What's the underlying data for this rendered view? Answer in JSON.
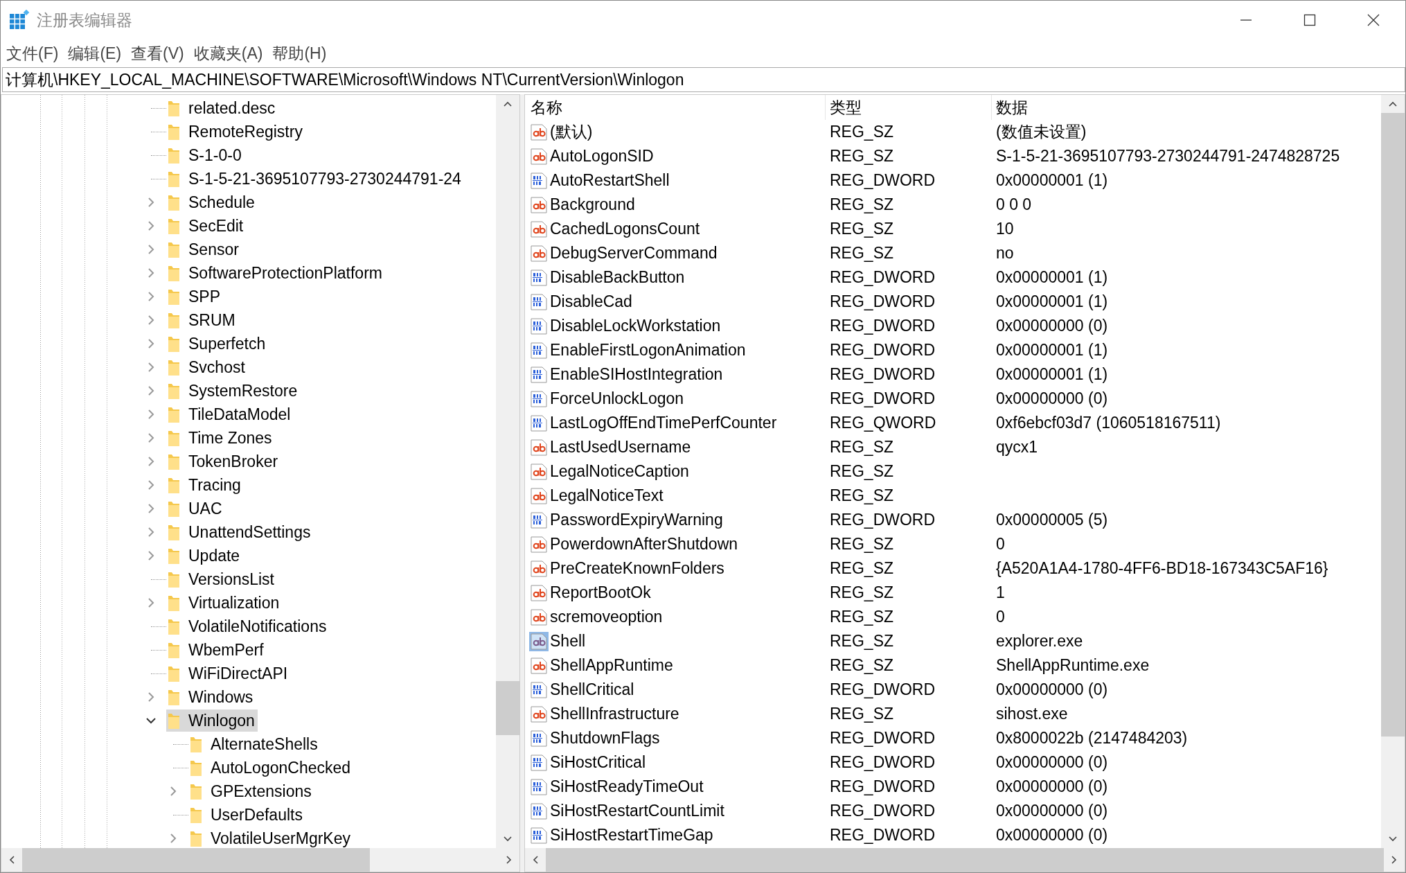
{
  "window": {
    "title": "注册表编辑器"
  },
  "menu": [
    "文件(F)",
    "编辑(E)",
    "查看(V)",
    "收藏夹(A)",
    "帮助(H)"
  ],
  "address": "计算机\\HKEY_LOCAL_MACHINE\\SOFTWARE\\Microsoft\\Windows NT\\CurrentVersion\\Winlogon",
  "tree": {
    "items": [
      {
        "label": "related.desc",
        "selected": false
      },
      {
        "label": "RemoteRegistry",
        "selected": false
      },
      {
        "label": "S-1-0-0",
        "selected": false
      },
      {
        "label": "S-1-5-21-3695107793-2730244791-24",
        "selected": false
      },
      {
        "label": "Schedule",
        "expanded": false,
        "selected": false
      },
      {
        "label": "SecEdit",
        "expanded": false,
        "selected": false
      },
      {
        "label": "Sensor",
        "expanded": false,
        "selected": false
      },
      {
        "label": "SoftwareProtectionPlatform",
        "expanded": false,
        "selected": false
      },
      {
        "label": "SPP",
        "expanded": false,
        "selected": false
      },
      {
        "label": "SRUM",
        "expanded": false,
        "selected": false
      },
      {
        "label": "Superfetch",
        "expanded": false,
        "selected": false
      },
      {
        "label": "Svchost",
        "expanded": false,
        "selected": false
      },
      {
        "label": "SystemRestore",
        "expanded": false,
        "selected": false
      },
      {
        "label": "TileDataModel",
        "expanded": false,
        "selected": false
      },
      {
        "label": "Time Zones",
        "expanded": false,
        "selected": false
      },
      {
        "label": "TokenBroker",
        "expanded": false,
        "selected": false
      },
      {
        "label": "Tracing",
        "expanded": false,
        "selected": false
      },
      {
        "label": "UAC",
        "expanded": false,
        "selected": false
      },
      {
        "label": "UnattendSettings",
        "expanded": false,
        "selected": false
      },
      {
        "label": "Update",
        "expanded": false,
        "selected": false
      },
      {
        "label": "VersionsList",
        "selected": false
      },
      {
        "label": "Virtualization",
        "expanded": false,
        "selected": false
      },
      {
        "label": "VolatileNotifications",
        "selected": false
      },
      {
        "label": "WbemPerf",
        "selected": false
      },
      {
        "label": "WiFiDirectAPI",
        "selected": false
      },
      {
        "label": "Windows",
        "expanded": false,
        "selected": false
      },
      {
        "label": "Winlogon",
        "expanded": true,
        "selected": true,
        "children": [
          {
            "label": "AlternateShells",
            "selected": false
          },
          {
            "label": "AutoLogonChecked",
            "selected": false
          },
          {
            "label": "GPExtensions",
            "expanded": false,
            "selected": false
          },
          {
            "label": "UserDefaults",
            "selected": false
          },
          {
            "label": "VolatileUserMgrKey",
            "expanded": false,
            "selected": false
          }
        ]
      }
    ]
  },
  "table": {
    "columns": [
      "名称",
      "类型",
      "数据"
    ],
    "rows": [
      {
        "kind": "string",
        "name": "(默认)",
        "type": "REG_SZ",
        "data": "(数值未设置)",
        "selected": false
      },
      {
        "kind": "string",
        "name": "AutoLogonSID",
        "type": "REG_SZ",
        "data": "S-1-5-21-3695107793-2730244791-2474828725",
        "selected": false
      },
      {
        "kind": "binary",
        "name": "AutoRestartShell",
        "type": "REG_DWORD",
        "data": "0x00000001 (1)",
        "selected": false
      },
      {
        "kind": "string",
        "name": "Background",
        "type": "REG_SZ",
        "data": "0 0 0",
        "selected": false
      },
      {
        "kind": "string",
        "name": "CachedLogonsCount",
        "type": "REG_SZ",
        "data": "10",
        "selected": false
      },
      {
        "kind": "string",
        "name": "DebugServerCommand",
        "type": "REG_SZ",
        "data": "no",
        "selected": false
      },
      {
        "kind": "binary",
        "name": "DisableBackButton",
        "type": "REG_DWORD",
        "data": "0x00000001 (1)",
        "selected": false
      },
      {
        "kind": "binary",
        "name": "DisableCad",
        "type": "REG_DWORD",
        "data": "0x00000001 (1)",
        "selected": false
      },
      {
        "kind": "binary",
        "name": "DisableLockWorkstation",
        "type": "REG_DWORD",
        "data": "0x00000000 (0)",
        "selected": false
      },
      {
        "kind": "binary",
        "name": "EnableFirstLogonAnimation",
        "type": "REG_DWORD",
        "data": "0x00000001 (1)",
        "selected": false
      },
      {
        "kind": "binary",
        "name": "EnableSIHostIntegration",
        "type": "REG_DWORD",
        "data": "0x00000001 (1)",
        "selected": false
      },
      {
        "kind": "binary",
        "name": "ForceUnlockLogon",
        "type": "REG_DWORD",
        "data": "0x00000000 (0)",
        "selected": false
      },
      {
        "kind": "binary",
        "name": "LastLogOffEndTimePerfCounter",
        "type": "REG_QWORD",
        "data": "0xf6ebcf03d7 (1060518167511)",
        "selected": false
      },
      {
        "kind": "string",
        "name": "LastUsedUsername",
        "type": "REG_SZ",
        "data": "qycx1",
        "selected": false
      },
      {
        "kind": "string",
        "name": "LegalNoticeCaption",
        "type": "REG_SZ",
        "selected": false
      },
      {
        "kind": "string",
        "name": "LegalNoticeText",
        "type": "REG_SZ",
        "selected": false
      },
      {
        "kind": "binary",
        "name": "PasswordExpiryWarning",
        "type": "REG_DWORD",
        "data": "0x00000005 (5)",
        "selected": false
      },
      {
        "kind": "string",
        "name": "PowerdownAfterShutdown",
        "type": "REG_SZ",
        "data": "0",
        "selected": false
      },
      {
        "kind": "string",
        "name": "PreCreateKnownFolders",
        "type": "REG_SZ",
        "data": "{A520A1A4-1780-4FF6-BD18-167343C5AF16}",
        "selected": false
      },
      {
        "kind": "string",
        "name": "ReportBootOk",
        "type": "REG_SZ",
        "data": "1",
        "selected": false
      },
      {
        "kind": "string",
        "name": "scremoveoption",
        "type": "REG_SZ",
        "data": "0",
        "selected": false
      },
      {
        "kind": "string",
        "name": "Shell",
        "type": "REG_SZ",
        "data": "explorer.exe",
        "selected": true
      },
      {
        "kind": "string",
        "name": "ShellAppRuntime",
        "type": "REG_SZ",
        "data": "ShellAppRuntime.exe",
        "selected": false
      },
      {
        "kind": "binary",
        "name": "ShellCritical",
        "type": "REG_DWORD",
        "data": "0x00000000 (0)",
        "selected": false
      },
      {
        "kind": "string",
        "name": "ShellInfrastructure",
        "type": "REG_SZ",
        "data": "sihost.exe",
        "selected": false
      },
      {
        "kind": "binary",
        "name": "ShutdownFlags",
        "type": "REG_DWORD",
        "data": "0x8000022b (2147484203)",
        "selected": false
      },
      {
        "kind": "binary",
        "name": "SiHostCritical",
        "type": "REG_DWORD",
        "data": "0x00000000 (0)",
        "selected": false
      },
      {
        "kind": "binary",
        "name": "SiHostReadyTimeOut",
        "type": "REG_DWORD",
        "data": "0x00000000 (0)",
        "selected": false
      },
      {
        "kind": "binary",
        "name": "SiHostRestartCountLimit",
        "type": "REG_DWORD",
        "data": "0x00000000 (0)",
        "selected": false
      },
      {
        "kind": "binary",
        "name": "SiHostRestartTimeGap",
        "type": "REG_DWORD",
        "data": "0x00000000 (0)",
        "selected": false
      }
    ]
  }
}
